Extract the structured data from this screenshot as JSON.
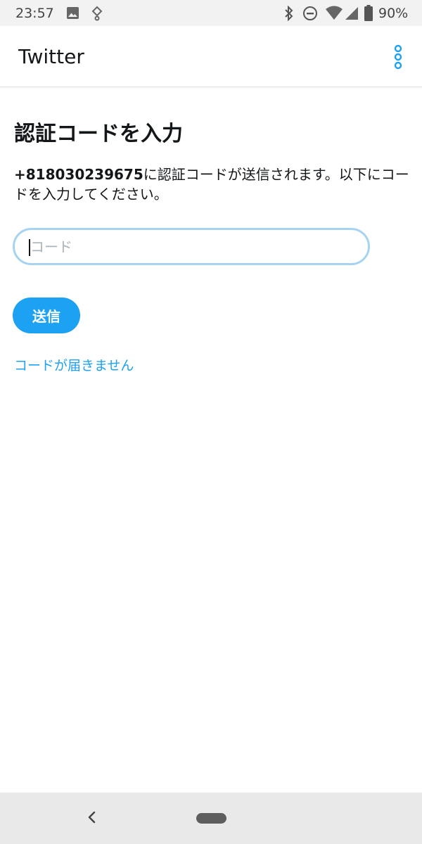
{
  "status_bar": {
    "time": "23:57",
    "battery": "90%",
    "icons": [
      "image-icon",
      "assistant-icon",
      "bluetooth-icon",
      "do-not-disturb-icon",
      "wifi-icon",
      "signal-icon",
      "battery-icon"
    ]
  },
  "app_bar": {
    "title": "Twitter",
    "menu_icon": "overflow-menu-icon"
  },
  "main": {
    "heading": "認証コードを入力",
    "phone_number": "+818030239675",
    "description": "に認証コードが送信されます。以下にコードを入力してください。",
    "code_input": {
      "placeholder": "コード",
      "value": ""
    },
    "send_label": "送信",
    "no_code_link": "コードが届きません"
  },
  "colors": {
    "accent": "#1da1f2",
    "input_border": "#a6d3f0",
    "text": "#14171a"
  },
  "nav_bar": {
    "icons": [
      "back-icon",
      "home-pill-icon"
    ]
  }
}
